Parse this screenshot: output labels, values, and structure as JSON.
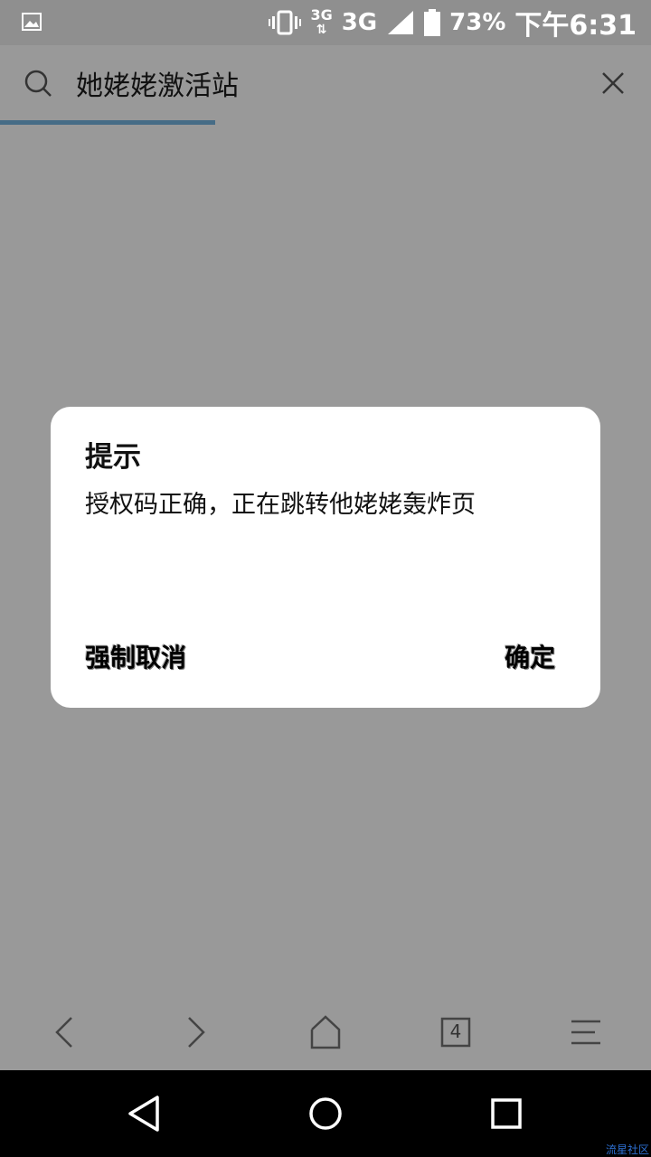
{
  "status_bar": {
    "network_small": "3G",
    "network": "3G",
    "battery": "73%",
    "time": "下午6:31",
    "icons": [
      "image-icon",
      "vibrate-icon",
      "signal-icon",
      "battery-icon"
    ]
  },
  "search": {
    "query": "她姥姥激活站",
    "icons": [
      "search-icon",
      "close-icon"
    ]
  },
  "dialog": {
    "title": "提示",
    "message": "授权码正确，正在跳转他姥姥轰炸页",
    "cancel_label": "强制取消",
    "ok_label": "确定"
  },
  "toolbar": {
    "tab_count": "4",
    "icons": [
      "back-icon",
      "forward-icon",
      "home-icon",
      "tabs-icon",
      "menu-icon"
    ]
  },
  "navbar": {
    "icons": [
      "nav-back-icon",
      "nav-home-icon",
      "nav-recents-icon"
    ]
  },
  "watermark": "流星社区",
  "colors": {
    "overlay": "#999999",
    "progress": "#466c86",
    "dialog_bg": "#ffffff",
    "navbar": "#000000"
  }
}
